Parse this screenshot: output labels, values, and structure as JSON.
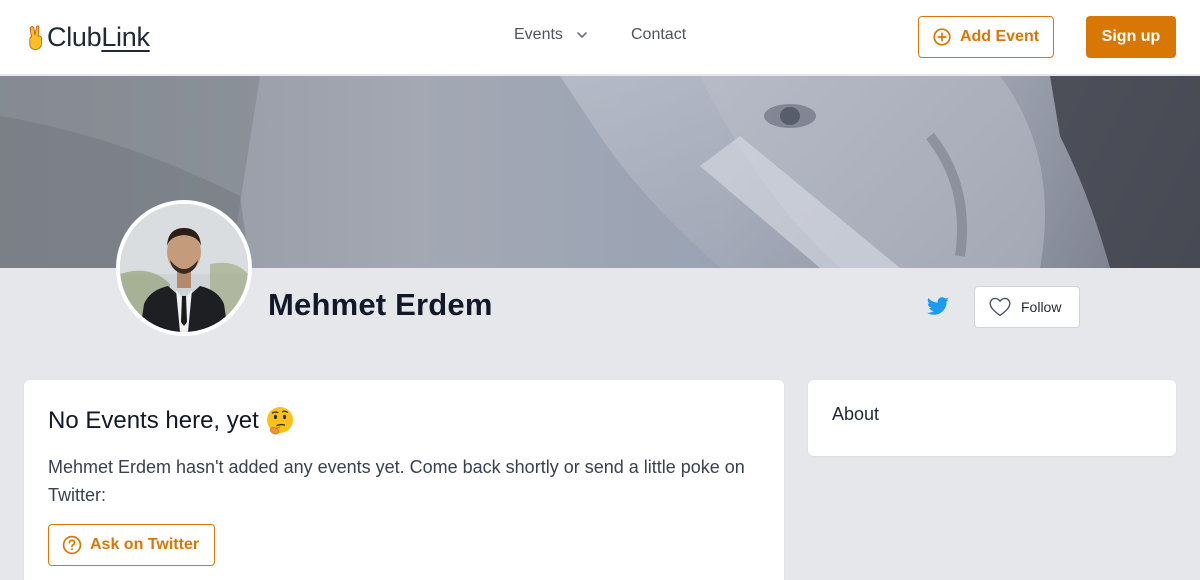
{
  "header": {
    "logo_club": "Club",
    "logo_link": "Link",
    "nav_events": "Events",
    "nav_contact": "Contact",
    "add_event_label": "Add Event",
    "signup_label": "Sign up"
  },
  "profile": {
    "name": "Mehmet Erdem",
    "follow_label": "Follow"
  },
  "events_card": {
    "title": "No Events here, yet",
    "text": "Mehmet Erdem hasn't added any events yet. Come back shortly or send a little poke on Twitter:",
    "ask_label": "Ask on Twitter"
  },
  "about_card": {
    "title": "About"
  },
  "icons": {
    "logo": "victory-hand-icon",
    "events_dropdown": "chevron-down-icon",
    "add_event": "plus-circle-icon",
    "twitter": "twitter-icon",
    "follow": "heart-icon",
    "title_emoji": "thinking-face-icon",
    "ask": "question-circle-icon"
  },
  "colors": {
    "accent": "#d97706",
    "page_bg": "#e5e7eb",
    "twitter": "#1d9bf0"
  }
}
